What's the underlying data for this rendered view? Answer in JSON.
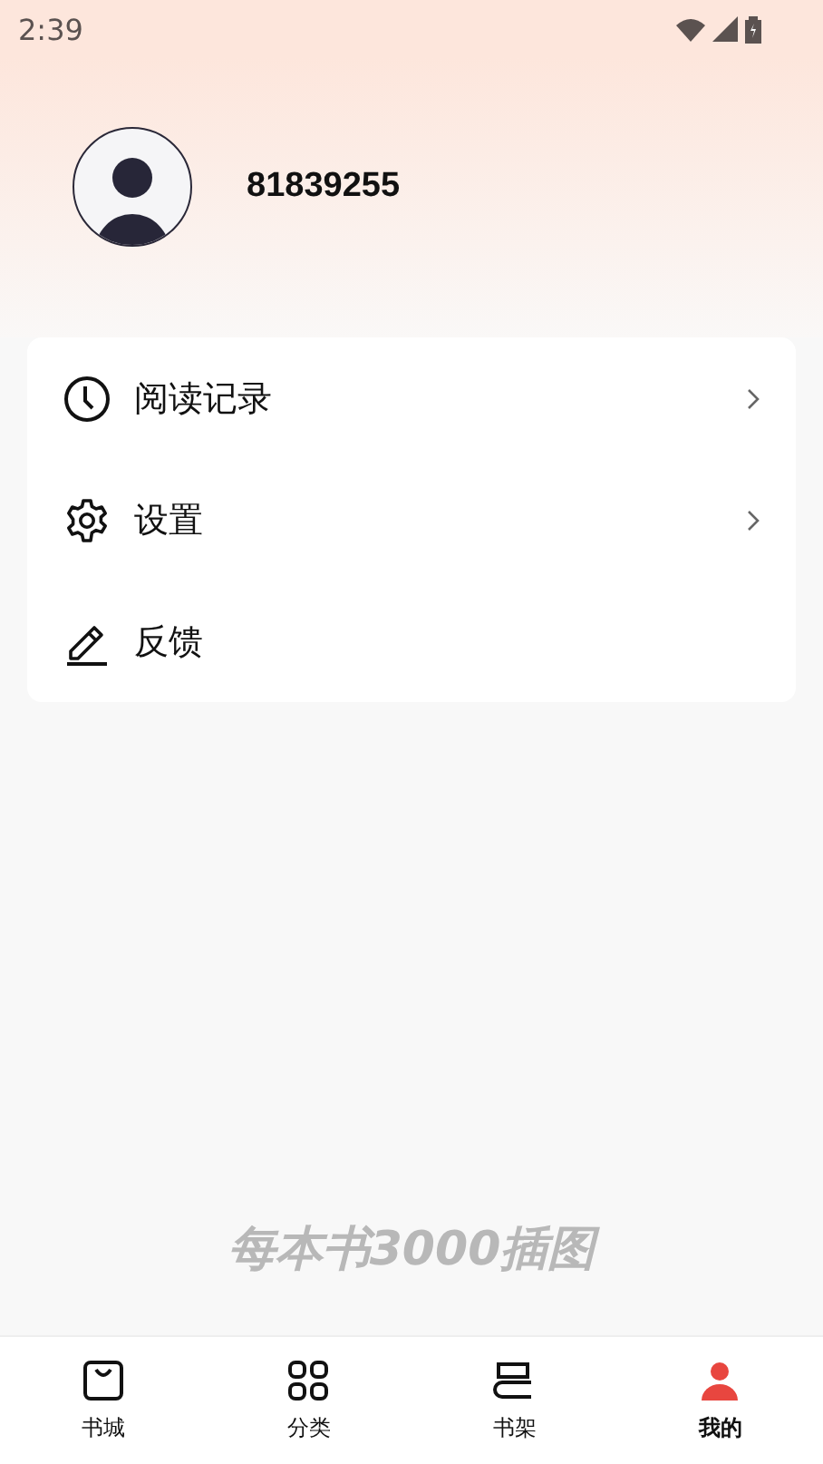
{
  "status_bar": {
    "time": "2:39"
  },
  "profile": {
    "username": "81839255"
  },
  "menu": [
    {
      "kind": "history",
      "label": "阅读记录",
      "chevron": true
    },
    {
      "kind": "settings",
      "label": "设置",
      "chevron": true
    },
    {
      "kind": "feedback",
      "label": "反馈",
      "chevron": false
    }
  ],
  "slogan": "每本书3000插图",
  "tabs": [
    {
      "kind": "store",
      "label": "书城",
      "selected": false
    },
    {
      "kind": "category",
      "label": "分类",
      "selected": false
    },
    {
      "kind": "shelf",
      "label": "书架",
      "selected": false
    },
    {
      "kind": "me",
      "label": "我的",
      "selected": true
    }
  ]
}
